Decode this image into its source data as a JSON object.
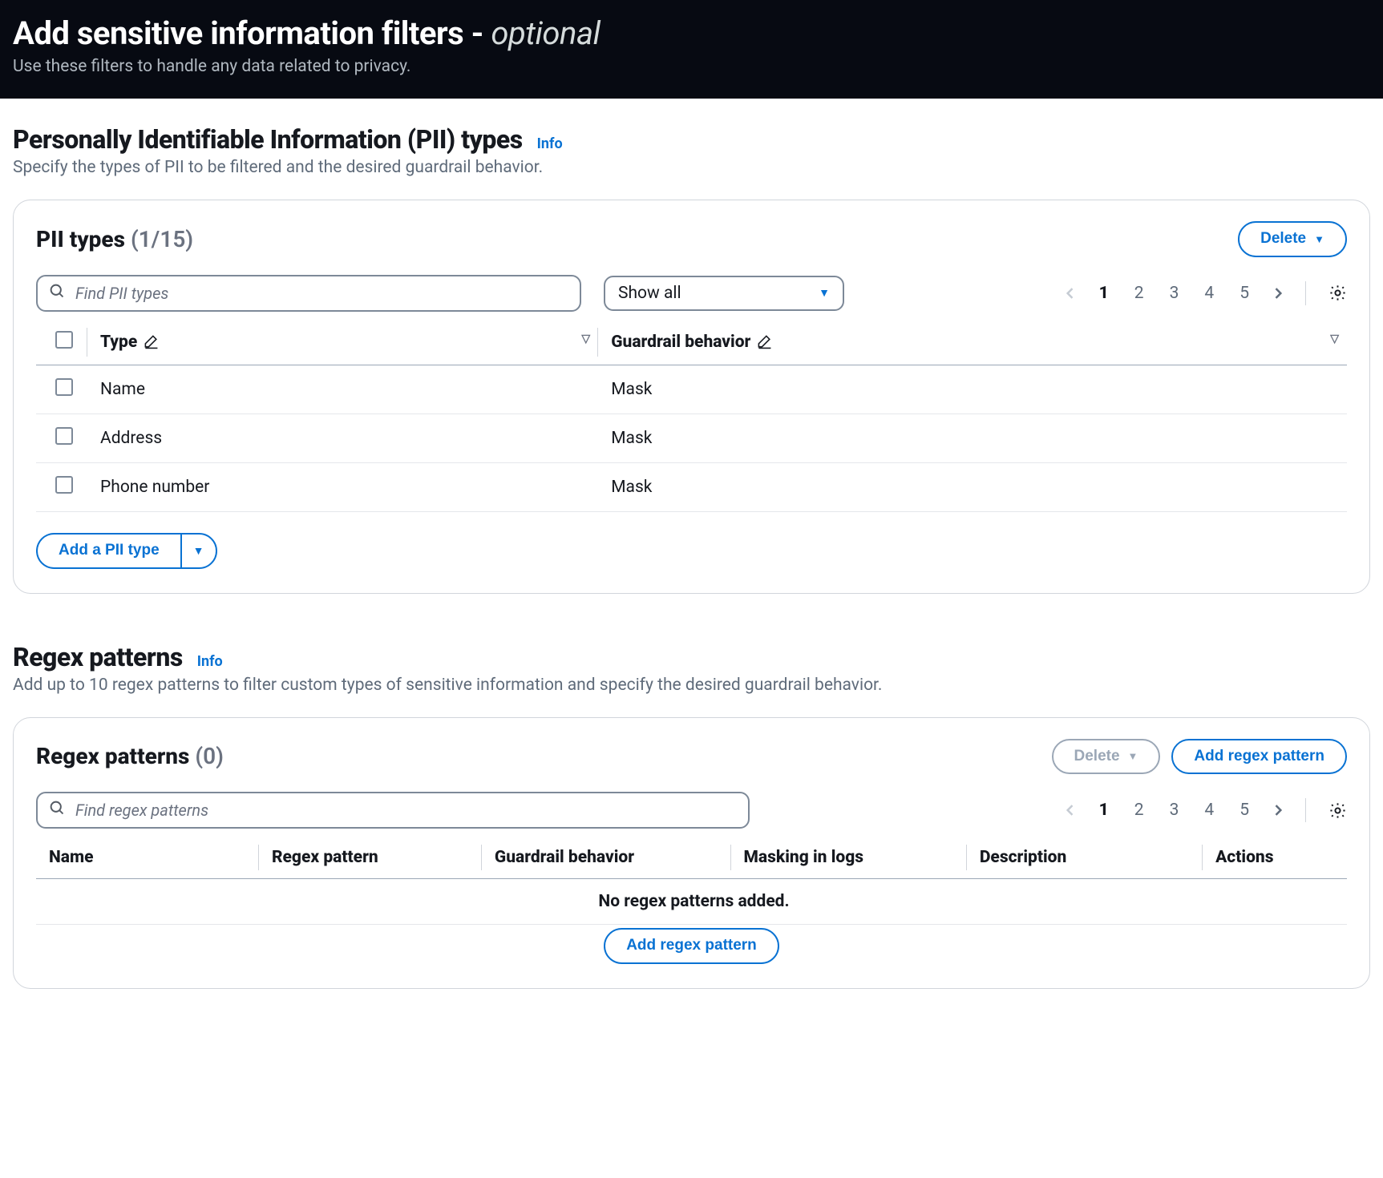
{
  "header": {
    "title_main": "Add sensitive information filters -",
    "title_optional": "optional",
    "subtitle": "Use these filters to handle any data related to privacy."
  },
  "pii_section": {
    "heading": "Personally Identifiable Information (PII) types",
    "info": "Info",
    "sub": "Specify the types of PII to be filtered and the desired guardrail behavior.",
    "card_title": "PII types",
    "count_label": "(1/15)",
    "delete_label": "Delete",
    "search_placeholder": "Find PII types",
    "filter_selected": "Show all",
    "columns": {
      "type": "Type",
      "behavior": "Guardrail behavior"
    },
    "rows": [
      {
        "type": "Name",
        "behavior": "Mask"
      },
      {
        "type": "Address",
        "behavior": "Mask"
      },
      {
        "type": "Phone number",
        "behavior": "Mask"
      }
    ],
    "add_label": "Add a PII type",
    "pager": {
      "pages": [
        "1",
        "2",
        "3",
        "4",
        "5"
      ],
      "current": "1"
    }
  },
  "regex_section": {
    "heading": "Regex patterns",
    "info": "Info",
    "sub": "Add up to 10 regex patterns to filter custom types of sensitive information and specify the desired guardrail behavior.",
    "card_title": "Regex patterns",
    "count_label": "(0)",
    "delete_label": "Delete",
    "add_label": "Add regex pattern",
    "search_placeholder": "Find regex patterns",
    "columns": {
      "name": "Name",
      "pattern": "Regex pattern",
      "behavior": "Guardrail behavior",
      "masking": "Masking in logs",
      "description": "Description",
      "actions": "Actions"
    },
    "empty_msg": "No regex patterns added.",
    "empty_action": "Add regex pattern",
    "pager": {
      "pages": [
        "1",
        "2",
        "3",
        "4",
        "5"
      ],
      "current": "1"
    }
  }
}
